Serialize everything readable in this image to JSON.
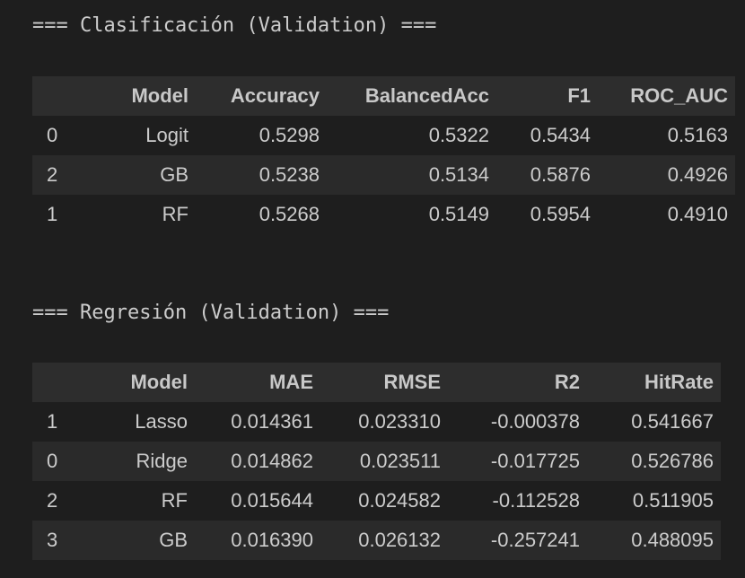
{
  "classification": {
    "heading": "=== Clasificación (Validation) ===",
    "columns": [
      "",
      "Model",
      "Accuracy",
      "BalancedAcc",
      "F1",
      "ROC_AUC"
    ],
    "rows": [
      [
        "0",
        "Logit",
        "0.5298",
        "0.5322",
        "0.5434",
        "0.5163"
      ],
      [
        "2",
        "GB",
        "0.5238",
        "0.5134",
        "0.5876",
        "0.4926"
      ],
      [
        "1",
        "RF",
        "0.5268",
        "0.5149",
        "0.5954",
        "0.4910"
      ]
    ]
  },
  "regression": {
    "heading": "=== Regresión (Validation) ===",
    "columns": [
      "",
      "Model",
      "MAE",
      "RMSE",
      "R2",
      "HitRate"
    ],
    "rows": [
      [
        "1",
        "Lasso",
        "0.014361",
        "0.023310",
        "-0.000378",
        "0.541667"
      ],
      [
        "0",
        "Ridge",
        "0.014862",
        "0.023511",
        "-0.017725",
        "0.526786"
      ],
      [
        "2",
        "RF",
        "0.015644",
        "0.024582",
        "-0.112528",
        "0.511905"
      ],
      [
        "3",
        "GB",
        "0.016390",
        "0.026132",
        "-0.257241",
        "0.488095"
      ]
    ]
  }
}
